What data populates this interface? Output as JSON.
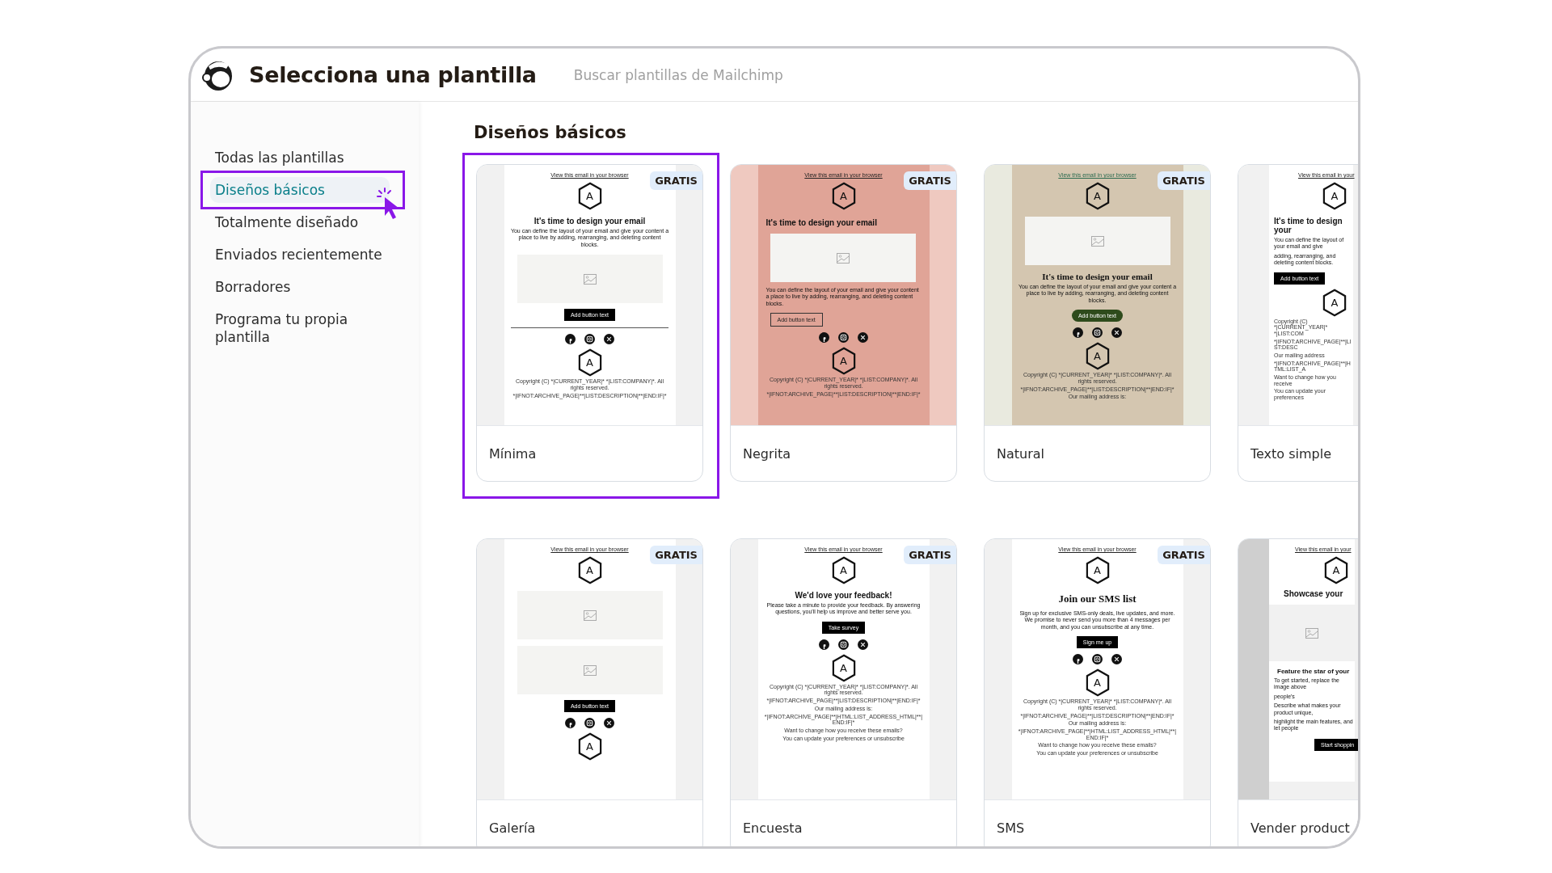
{
  "header": {
    "title": "Selecciona una plantilla",
    "search": {
      "placeholder": "Buscar plantillas de Mailchimp"
    }
  },
  "sidebar": {
    "items": [
      {
        "label": "Todas las plantillas",
        "selected": false
      },
      {
        "label": "Diseños básicos",
        "selected": true
      },
      {
        "label": "Totalmente diseñado",
        "selected": false
      },
      {
        "label": "Enviados recientemente",
        "selected": false
      },
      {
        "label": "Borradores",
        "selected": false
      },
      {
        "label": "Programa tu propia plantilla",
        "selected": false
      }
    ]
  },
  "section": {
    "title": "Diseños básicos",
    "templates": [
      {
        "name": "Mínima",
        "kind": "minimal",
        "badge": "GRATIS",
        "selected": true,
        "preview": [
          {
            "kind": "link",
            "text": "View this email in your browser"
          },
          {
            "kind": "logo",
            "text": "A"
          },
          {
            "kind": "heading",
            "text": "It's time to design your email"
          },
          {
            "kind": "body",
            "text": "You can define the layout of your email and give your content a place to live by adding, rearranging, and deleting content blocks."
          },
          {
            "kind": "image"
          },
          {
            "kind": "button",
            "text": "Add button text"
          },
          {
            "kind": "divider"
          },
          {
            "kind": "social"
          },
          {
            "kind": "logo",
            "text": "A"
          },
          {
            "kind": "fine",
            "text": "Copyright (C) *|CURRENT_YEAR|* *|LIST:COMPANY|*. All rights reserved."
          },
          {
            "kind": "fine",
            "text": "*|IFNOT:ARCHIVE_PAGE|**|LIST:DESCRIPTION|**|END:IF|*"
          }
        ]
      },
      {
        "name": "Negrita",
        "kind": "bold",
        "badge": "GRATIS",
        "selected": false,
        "preview": [
          {
            "kind": "link",
            "text": "View this email in your browser"
          },
          {
            "kind": "logo",
            "text": "A"
          },
          {
            "kind": "heading",
            "text": "It's time to design your email"
          },
          {
            "kind": "image"
          },
          {
            "kind": "body",
            "text": "You can define the layout of your email and give your content a place to live by adding, rearranging, and deleting content blocks."
          },
          {
            "kind": "button",
            "text": "Add button text"
          },
          {
            "kind": "social"
          },
          {
            "kind": "logo",
            "text": "A"
          },
          {
            "kind": "fine",
            "text": "Copyright (C) *|CURRENT_YEAR|* *|LIST:COMPANY|*. All rights reserved."
          },
          {
            "kind": "fine",
            "text": "*|IFNOT:ARCHIVE_PAGE|**|LIST:DESCRIPTION|**|END:IF|*"
          }
        ]
      },
      {
        "name": "Natural",
        "kind": "natural",
        "badge": "GRATIS",
        "selected": false,
        "preview": [
          {
            "kind": "link",
            "text": "View this email in your browser"
          },
          {
            "kind": "logo",
            "text": "A"
          },
          {
            "kind": "image"
          },
          {
            "kind": "heading",
            "text": "It's time to design your email"
          },
          {
            "kind": "body",
            "text": "You can define the layout of your email and give your content a place to live by adding, rearranging, and deleting content blocks."
          },
          {
            "kind": "button",
            "text": "Add button text"
          },
          {
            "kind": "social"
          },
          {
            "kind": "logo",
            "text": "A"
          },
          {
            "kind": "fine",
            "text": "Copyright (C) *|CURRENT_YEAR|* *|LIST:COMPANY|*. All rights reserved."
          },
          {
            "kind": "fine",
            "text": "*|IFNOT:ARCHIVE_PAGE|**|LIST:DESCRIPTION|**|END:IF|*"
          },
          {
            "kind": "fine",
            "text": "Our mailing address is:"
          }
        ]
      },
      {
        "name": "Texto simple",
        "kind": "plain",
        "selected": false,
        "preview": [
          {
            "kind": "link",
            "text": "View this email in your"
          },
          {
            "kind": "logo",
            "text": "A"
          },
          {
            "kind": "heading",
            "text": "It's time to design your"
          },
          {
            "kind": "body",
            "text": "You can define the layout of your email and give"
          },
          {
            "kind": "body",
            "text": "adding, rearranging, and deleting content blocks."
          },
          {
            "kind": "button",
            "text": "Add button text"
          },
          {
            "kind": "logo",
            "text": "A"
          },
          {
            "kind": "fine",
            "text": "Copyright (C) *|CURRENT_YEAR|* *|LIST:COM"
          },
          {
            "kind": "fine",
            "text": "*|IFNOT:ARCHIVE_PAGE|**|LIST:DESC"
          },
          {
            "kind": "fine",
            "text": "Our mailing address"
          },
          {
            "kind": "fine",
            "text": "*|IFNOT:ARCHIVE_PAGE|**|HTML:LIST_A"
          },
          {
            "kind": "fine",
            "text": "Want to change how you receive"
          },
          {
            "kind": "fine",
            "text": "You can update your preferences"
          }
        ]
      },
      {
        "name": "Galería",
        "kind": "gallery",
        "badge": "GRATIS",
        "selected": false,
        "preview": [
          {
            "kind": "link",
            "text": "View this email in your browser"
          },
          {
            "kind": "logo",
            "text": "A"
          },
          {
            "kind": "image"
          },
          {
            "kind": "image"
          },
          {
            "kind": "button",
            "text": "Add button text"
          },
          {
            "kind": "social"
          },
          {
            "kind": "logo",
            "text": "A"
          }
        ]
      },
      {
        "name": "Encuesta",
        "kind": "survey",
        "badge": "GRATIS",
        "selected": false,
        "preview": [
          {
            "kind": "link",
            "text": "View this email in your browser"
          },
          {
            "kind": "logo",
            "text": "A"
          },
          {
            "kind": "heading",
            "text": "We'd love your feedback!"
          },
          {
            "kind": "body",
            "text": "Please take a minute to provide your feedback. By answering questions, you'll help us improve and better serve you."
          },
          {
            "kind": "button",
            "text": "Take survey"
          },
          {
            "kind": "social"
          },
          {
            "kind": "logo",
            "text": "A"
          },
          {
            "kind": "fine",
            "text": "Copyright (C) *|CURRENT_YEAR|* *|LIST:COMPANY|*. All rights reserved."
          },
          {
            "kind": "fine",
            "text": "*|IFNOT:ARCHIVE_PAGE|**|LIST:DESCRIPTION|**|END:IF|*"
          },
          {
            "kind": "fine",
            "text": "Our mailing address is:"
          },
          {
            "kind": "fine",
            "text": "*|IFNOT:ARCHIVE_PAGE|**|HTML:LIST_ADDRESS_HTML|**|END:IF|*"
          },
          {
            "kind": "fine",
            "text": "Want to change how you receive these emails?"
          },
          {
            "kind": "fine",
            "text": "You can update your preferences or unsubscribe"
          }
        ]
      },
      {
        "name": "SMS",
        "kind": "sms",
        "badge": "GRATIS",
        "selected": false,
        "preview": [
          {
            "kind": "link",
            "text": "View this email in your browser"
          },
          {
            "kind": "logo",
            "text": "A"
          },
          {
            "kind": "heading",
            "text": "Join our SMS list"
          },
          {
            "kind": "body",
            "text": "Sign up for exclusive SMS-only deals, live updates, and more. We promise to never send you more than 4 messages per month, and you can unsubscribe at any time."
          },
          {
            "kind": "button",
            "text": "Sign me up"
          },
          {
            "kind": "social"
          },
          {
            "kind": "logo",
            "text": "A"
          },
          {
            "kind": "fine",
            "text": "Copyright (C) *|CURRENT_YEAR|* *|LIST:COMPANY|*. All rights reserved."
          },
          {
            "kind": "fine",
            "text": "*|IFNOT:ARCHIVE_PAGE|**|LIST:DESCRIPTION|**|END:IF|*"
          },
          {
            "kind": "fine",
            "text": "Our mailing address is:"
          },
          {
            "kind": "fine",
            "text": "*|IFNOT:ARCHIVE_PAGE|**|HTML:LIST_ADDRESS_HTML|**|END:IF|*"
          },
          {
            "kind": "fine",
            "text": "Want to change how you receive these emails?"
          },
          {
            "kind": "fine",
            "text": "You can update your preferences or unsubscribe"
          }
        ]
      },
      {
        "name": "Vender product",
        "kind": "product",
        "selected": false,
        "preview": [
          {
            "kind": "link",
            "text": "View this email in your"
          },
          {
            "kind": "logo",
            "text": "A"
          },
          {
            "kind": "heading",
            "text": "Showcase your"
          },
          {
            "kind": "image"
          },
          {
            "kind": "subheading",
            "text": "Feature the star of your"
          },
          {
            "kind": "body",
            "text": "To get started, replace the image above"
          },
          {
            "kind": "body",
            "text": "people's"
          },
          {
            "kind": "body",
            "text": "Describe what makes your product unique,"
          },
          {
            "kind": "body",
            "text": "highlight the main features, and let people"
          },
          {
            "kind": "button",
            "text": "Start shoppin"
          }
        ]
      }
    ]
  }
}
